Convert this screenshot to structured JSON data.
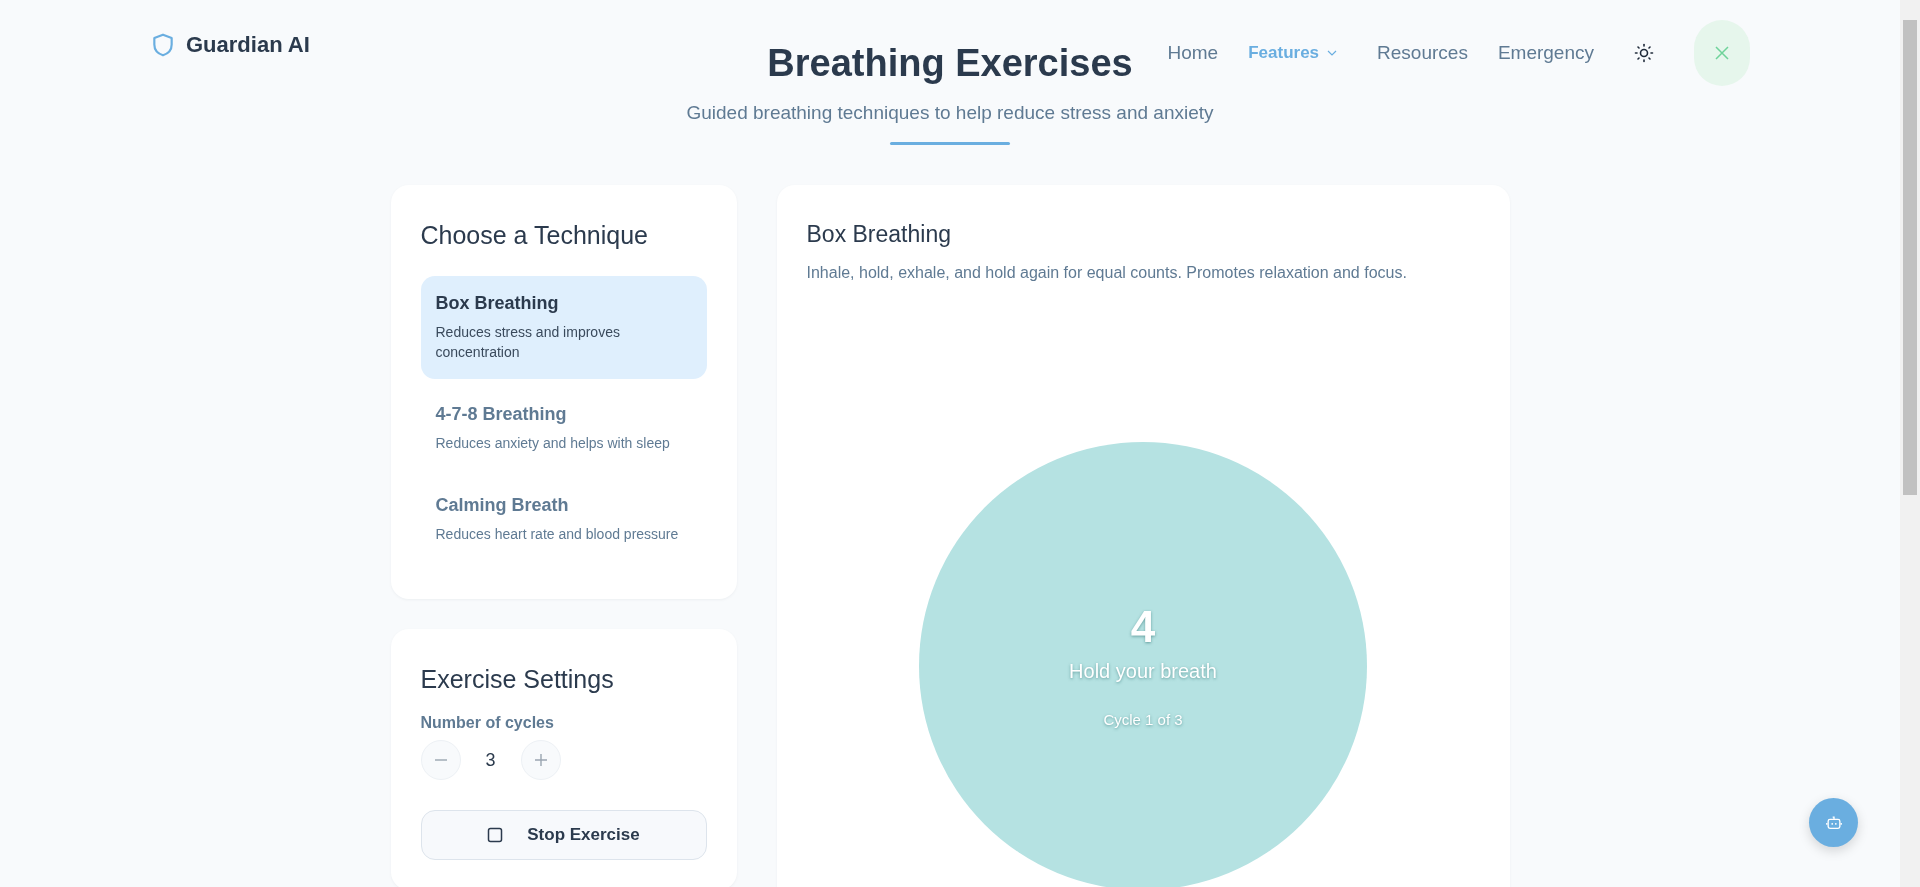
{
  "brand": {
    "name": "Guardian AI"
  },
  "hero": {
    "title": "Breathing Exercises",
    "subtitle": "Guided breathing techniques to help reduce stress and anxiety"
  },
  "nav": [
    {
      "label": "Home",
      "selected": false,
      "dropdown": false
    },
    {
      "label": "Features",
      "selected": true,
      "dropdown": true
    },
    {
      "label": "Resources",
      "selected": false,
      "dropdown": false
    },
    {
      "label": "Emergency",
      "selected": false,
      "dropdown": false
    }
  ],
  "techniques_panel": {
    "title": "Choose a Technique",
    "items": [
      {
        "name": "Box Breathing",
        "description": "Reduces stress and improves concentration",
        "selected": true
      },
      {
        "name": "4-7-8 Breathing",
        "description": "Reduces anxiety and helps with sleep",
        "selected": false
      },
      {
        "name": "Calming Breath",
        "description": "Reduces heart rate and blood pressure",
        "selected": false
      }
    ]
  },
  "settings": {
    "title": "Exercise Settings",
    "cycles_label": "Number of cycles",
    "cycles": "3",
    "action": {
      "label": "Stop Exercise",
      "running": true
    }
  },
  "exercise": {
    "title": "Box Breathing",
    "description": "Inhale, hold, exhale, and hold again for equal counts. Promotes relaxation and focus.",
    "count": "4",
    "instruction": "Hold your breath",
    "cycle": "Cycle 1 of 3"
  }
}
